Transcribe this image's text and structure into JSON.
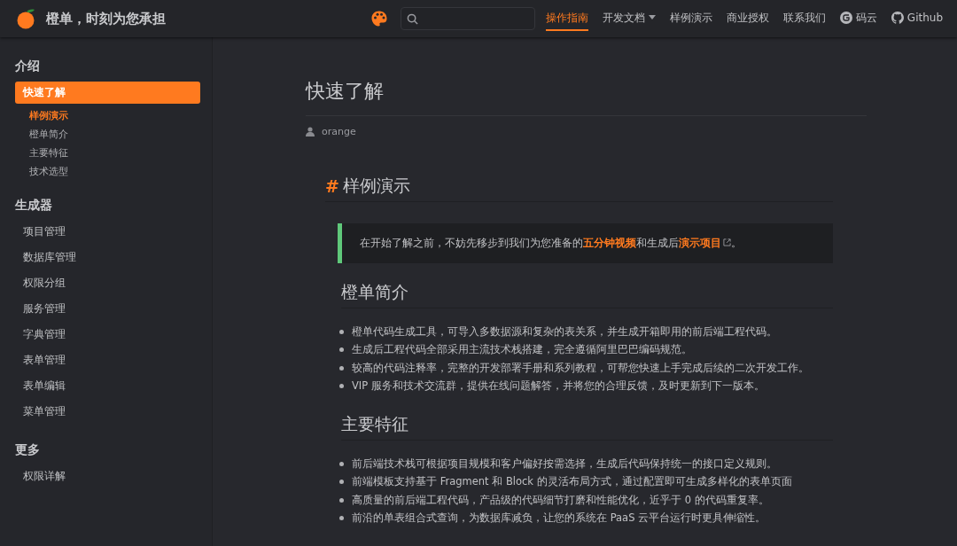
{
  "header": {
    "title": "橙单，时刻为您承担",
    "nav": [
      {
        "label": "操作指南",
        "kind": "text",
        "selected": true
      },
      {
        "label": "开发文档",
        "kind": "dropdown",
        "selected": false
      },
      {
        "label": "样例演示",
        "kind": "text",
        "selected": false
      },
      {
        "label": "商业授权",
        "kind": "text",
        "selected": false
      },
      {
        "label": "联系我们",
        "kind": "text",
        "selected": false
      },
      {
        "label": "码云",
        "kind": "gitee",
        "selected": false
      },
      {
        "label": "Github",
        "kind": "github",
        "selected": false
      }
    ]
  },
  "sidebar": {
    "groups": [
      {
        "title": "介绍",
        "items": [
          {
            "label": "快速了解",
            "selected": true,
            "children": [
              {
                "label": "样例演示",
                "selected": true
              },
              {
                "label": "橙单简介",
                "selected": false
              },
              {
                "label": "主要特征",
                "selected": false
              },
              {
                "label": "技术选型",
                "selected": false
              }
            ]
          }
        ]
      },
      {
        "title": "生成器",
        "items": [
          {
            "label": "项目管理",
            "selected": false
          },
          {
            "label": "数据库管理",
            "selected": false
          },
          {
            "label": "权限分组",
            "selected": false
          },
          {
            "label": "服务管理",
            "selected": false
          },
          {
            "label": "字典管理",
            "selected": false
          },
          {
            "label": "表单管理",
            "selected": false
          },
          {
            "label": "表单编辑",
            "selected": false
          },
          {
            "label": "菜单管理",
            "selected": false
          }
        ]
      },
      {
        "title": "更多",
        "items": [
          {
            "label": "权限详解",
            "selected": false
          }
        ]
      }
    ]
  },
  "page": {
    "title": "快速了解",
    "author": "orange",
    "sections": [
      {
        "heading": "样例演示",
        "anchor": "#",
        "callout": [
          {
            "kind": "text",
            "text": "在开始了解之前，不妨先移步到我们为您准备的"
          },
          {
            "kind": "link",
            "text": "五分钟视频"
          },
          {
            "kind": "text",
            "text": "和生成后"
          },
          {
            "kind": "external-link",
            "text": "演示项目"
          },
          {
            "kind": "text",
            "text": "。"
          }
        ]
      },
      {
        "heading": "橙单简介",
        "items": [
          "橙单代码生成工具，可导入多数据源和复杂的表关系，并生成开箱即用的前后端工程代码。",
          "生成后工程代码全部采用主流技术栈搭建，完全遵循阿里巴巴编码规范。",
          "较高的代码注释率，完整的开发部署手册和系列教程，可帮您快速上手完成后续的二次开发工作。",
          "VIP 服务和技术交流群，提供在线问题解答，并将您的合理反馈，及时更新到下一版本。"
        ]
      },
      {
        "heading": "主要特征",
        "items": [
          "前后端技术栈可根据项目规模和客户偏好按需选择，生成后代码保持统一的接口定义规则。",
          "前端模板支持基于 Fragment 和 Block 的灵活布局方式，通过配置即可生成多样化的表单页面",
          "高质量的前后端工程代码，产品级的代码细节打磨和性能优化，近乎于 0 的代码重复率。",
          "前沿的单表组合式查询，为数据库减负，让您的系统在 PaaS 云平台运行时更具伸缩性。"
        ]
      }
    ]
  }
}
